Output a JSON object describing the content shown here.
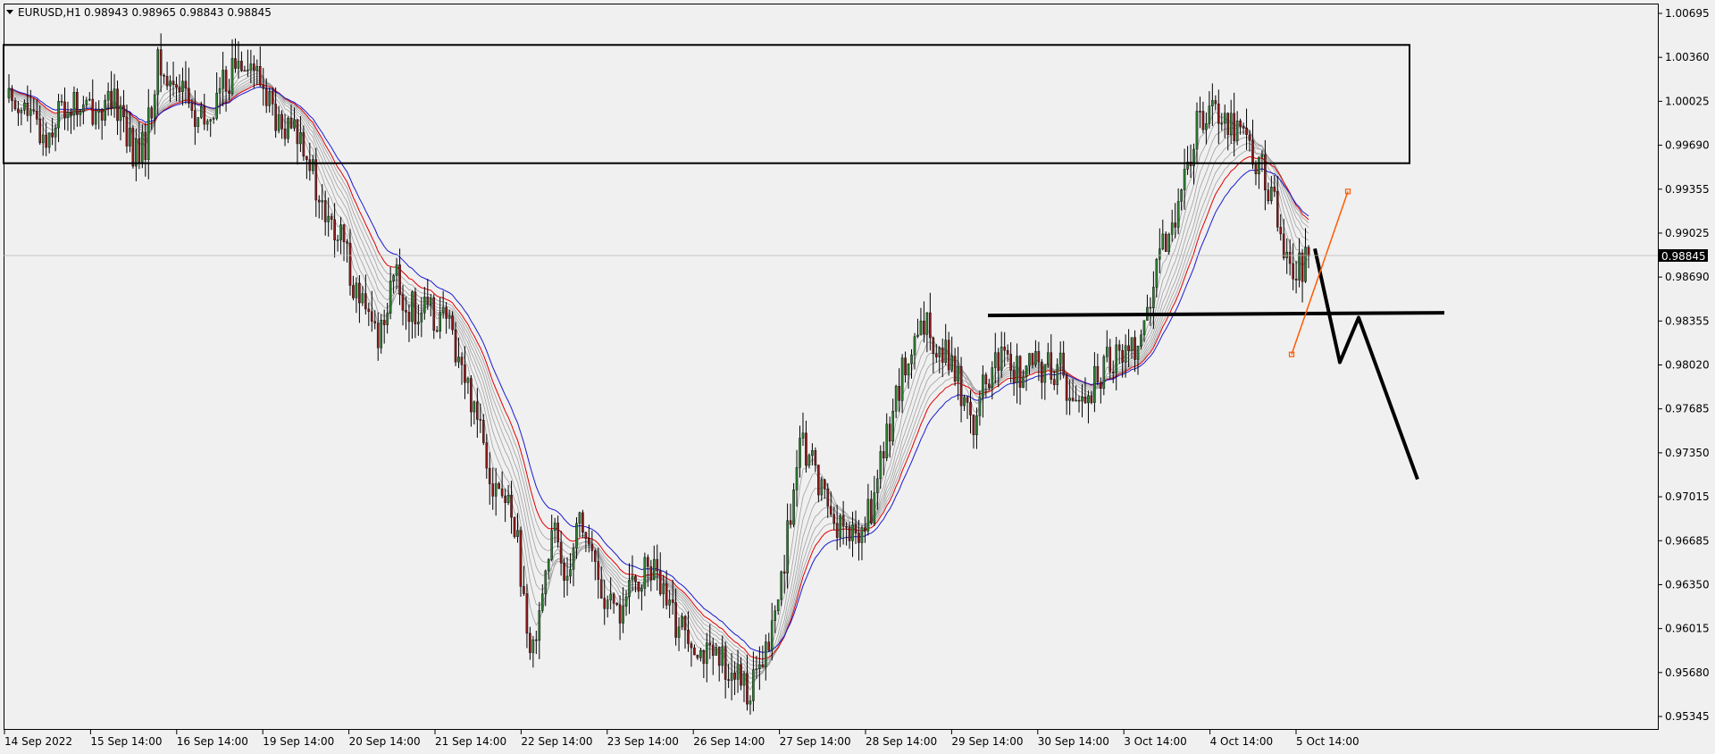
{
  "header": {
    "symbol": "EURUSD,H1",
    "ohlc": "0.98943 0.98965 0.98843 0.98845"
  },
  "current_price": "0.98845",
  "colors": {
    "background": "#f0f0f0",
    "bull_candle": "#2e7d32",
    "bear_candle": "#8b1a1a",
    "ema_red": "#e00000",
    "ema_blue": "#1a1ad0",
    "ema_gray": "#a0a0a0",
    "drawing_black": "#000000",
    "drawing_orange": "#ff5a00",
    "price_tag_bg": "#000000"
  },
  "chart_data": {
    "type": "candlestick",
    "title": "EURUSD,H1",
    "x_tick_labels": [
      "14 Sep 2022",
      "15 Sep 14:00",
      "16 Sep 14:00",
      "19 Sep 14:00",
      "20 Sep 14:00",
      "21 Sep 14:00",
      "22 Sep 14:00",
      "23 Sep 14:00",
      "26 Sep 14:00",
      "27 Sep 14:00",
      "28 Sep 14:00",
      "29 Sep 14:00",
      "30 Sep 14:00",
      "3 Oct 14:00",
      "4 Oct 14:00",
      "5 Oct 14:00"
    ],
    "y_tick_labels": [
      "1.00695",
      "1.00360",
      "1.00025",
      "0.99690",
      "0.99355",
      "0.99025",
      "0.98690",
      "0.98355",
      "0.98020",
      "0.97685",
      "0.97350",
      "0.97015",
      "0.96685",
      "0.96350",
      "0.96015",
      "0.95680",
      "0.95345"
    ],
    "ylim": [
      0.9521,
      1.0077
    ],
    "close_path": [
      [
        0,
        1.0005
      ],
      [
        1,
        1.0001
      ],
      [
        2,
        0.9985
      ],
      [
        3,
        0.9975
      ],
      [
        4,
        0.9995
      ],
      [
        5,
        1.0
      ],
      [
        6,
        0.9995
      ],
      [
        7,
        0.9998
      ],
      [
        8,
        0.9997
      ],
      [
        9,
        1.0
      ],
      [
        10,
        0.9962
      ],
      [
        11,
        0.9968
      ],
      [
        12,
        1.003
      ],
      [
        13,
        1.0015
      ],
      [
        14,
        1.002
      ],
      [
        15,
        0.9985
      ],
      [
        16,
        0.9985
      ],
      [
        17,
        1.001
      ],
      [
        18,
        1.0025
      ],
      [
        19,
        1.004
      ],
      [
        20,
        1.0022
      ],
      [
        21,
        1.0005
      ],
      [
        22,
        0.9975
      ],
      [
        23,
        0.998
      ],
      [
        24,
        0.9972
      ],
      [
        25,
        0.9925
      ],
      [
        26,
        0.9905
      ],
      [
        27,
        0.9895
      ],
      [
        28,
        0.986
      ],
      [
        29,
        0.9835
      ],
      [
        30,
        0.9825
      ],
      [
        31,
        0.9875
      ],
      [
        32,
        0.9845
      ],
      [
        33,
        0.9845
      ],
      [
        34,
        0.984
      ],
      [
        35,
        0.984
      ],
      [
        36,
        0.982
      ],
      [
        37,
        0.9785
      ],
      [
        38,
        0.9765
      ],
      [
        39,
        0.9715
      ],
      [
        40,
        0.97
      ],
      [
        41,
        0.968
      ],
      [
        42,
        0.957
      ],
      [
        43,
        0.963
      ],
      [
        44,
        0.9675
      ],
      [
        45,
        0.964
      ],
      [
        46,
        0.969
      ],
      [
        47,
        0.966
      ],
      [
        48,
        0.9625
      ],
      [
        49,
        0.961
      ],
      [
        50,
        0.9625
      ],
      [
        51,
        0.964
      ],
      [
        52,
        0.965
      ],
      [
        53,
        0.962
      ],
      [
        54,
        0.9605
      ],
      [
        55,
        0.96
      ],
      [
        56,
        0.9585
      ],
      [
        57,
        0.9575
      ],
      [
        58,
        0.9575
      ],
      [
        59,
        0.956
      ],
      [
        60,
        0.9555
      ],
      [
        61,
        0.9575
      ],
      [
        62,
        0.9615
      ],
      [
        63,
        0.968
      ],
      [
        64,
        0.974
      ],
      [
        65,
        0.9725
      ],
      [
        66,
        0.97
      ],
      [
        67,
        0.968
      ],
      [
        68,
        0.967
      ],
      [
        69,
        0.9675
      ],
      [
        70,
        0.9705
      ],
      [
        71,
        0.975
      ],
      [
        72,
        0.979
      ],
      [
        73,
        0.981
      ],
      [
        74,
        0.983
      ],
      [
        75,
        0.982
      ],
      [
        76,
        0.981
      ],
      [
        77,
        0.978
      ],
      [
        78,
        0.976
      ],
      [
        79,
        0.979
      ],
      [
        80,
        0.9805
      ],
      [
        81,
        0.98
      ],
      [
        82,
        0.9795
      ],
      [
        83,
        0.98
      ],
      [
        84,
        0.98
      ],
      [
        85,
        0.98
      ],
      [
        86,
        0.977
      ],
      [
        87,
        0.978
      ],
      [
        88,
        0.979
      ],
      [
        89,
        0.981
      ],
      [
        90,
        0.981
      ],
      [
        91,
        0.982
      ],
      [
        92,
        0.984
      ],
      [
        93,
        0.988
      ],
      [
        94,
        0.9915
      ],
      [
        95,
        0.994
      ],
      [
        96,
        0.9985
      ],
      [
        97,
        1.0005
      ],
      [
        98,
        0.9995
      ],
      [
        99,
        0.9985
      ],
      [
        100,
        0.9975
      ],
      [
        101,
        0.9955
      ],
      [
        102,
        0.993
      ],
      [
        103,
        0.9895
      ],
      [
        104,
        0.987
      ],
      [
        105,
        0.9885
      ]
    ],
    "drawings": {
      "resistance_box": {
        "price_top": 1.00455,
        "price_bottom": 0.99555,
        "time_start": "14 Sep 2022",
        "time_end": "5 Oct 14:00"
      },
      "support_line": {
        "price": 0.9841
      },
      "forecast_path": [
        [
          0.98905,
          "current"
        ],
        [
          0.9804,
          "+1"
        ],
        [
          0.9838,
          "+2"
        ],
        [
          0.9715,
          "+3"
        ]
      ],
      "orange_line": [
        [
          0.981,
          "start"
        ],
        [
          0.9934,
          "end"
        ]
      ]
    }
  }
}
